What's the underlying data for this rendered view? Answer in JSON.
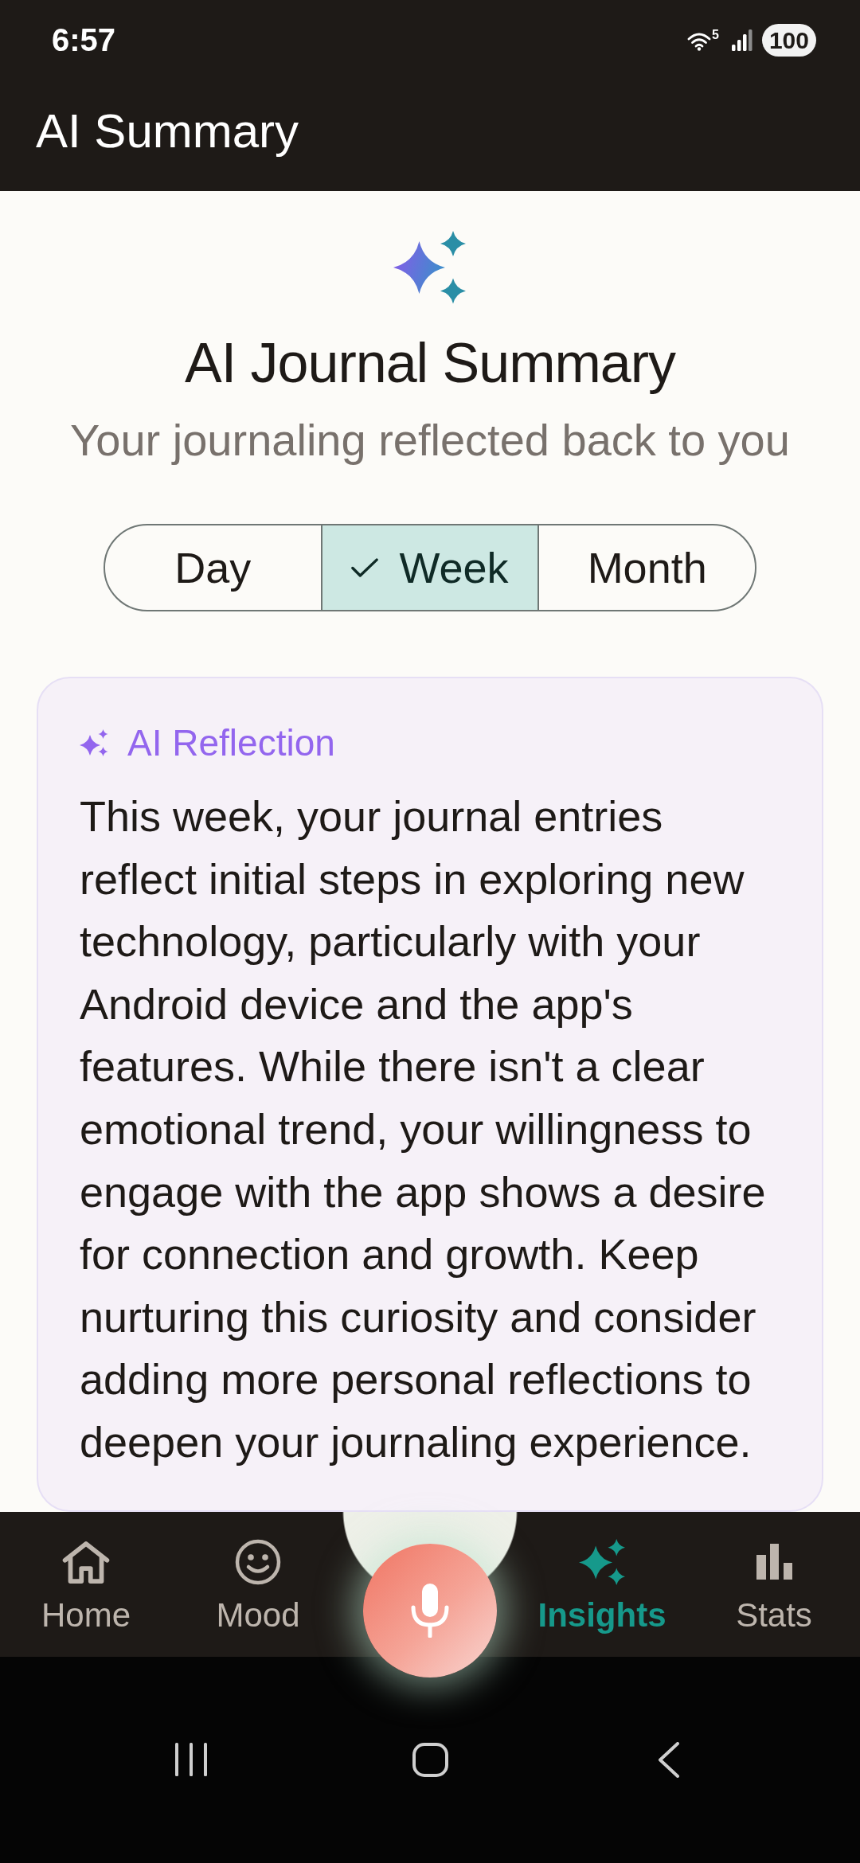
{
  "status_bar": {
    "time": "6:57",
    "wifi_band": "5",
    "battery": "100"
  },
  "app_bar": {
    "title": "AI Summary"
  },
  "header": {
    "title": "AI Journal Summary",
    "subtitle": "Your journaling reflected back to you"
  },
  "period_tabs": [
    {
      "label": "Day",
      "selected": false
    },
    {
      "label": "Week",
      "selected": true
    },
    {
      "label": "Month",
      "selected": false
    }
  ],
  "reflection_card": {
    "label": "AI Reflection",
    "text": "This week, your journal entries reflect initial steps in exploring new technology, particularly with your Android device and the app's features. While there isn't a clear emotional trend, your willingness to engage with the app shows a desire for connection and growth. Keep nurturing this curiosity and consider adding more personal reflections to deepen your journaling experience."
  },
  "bottom_nav": {
    "items": [
      {
        "label": "Home",
        "selected": false
      },
      {
        "label": "Mood",
        "selected": false
      },
      {
        "label": "Insights",
        "selected": true
      },
      {
        "label": "Stats",
        "selected": false
      }
    ]
  }
}
